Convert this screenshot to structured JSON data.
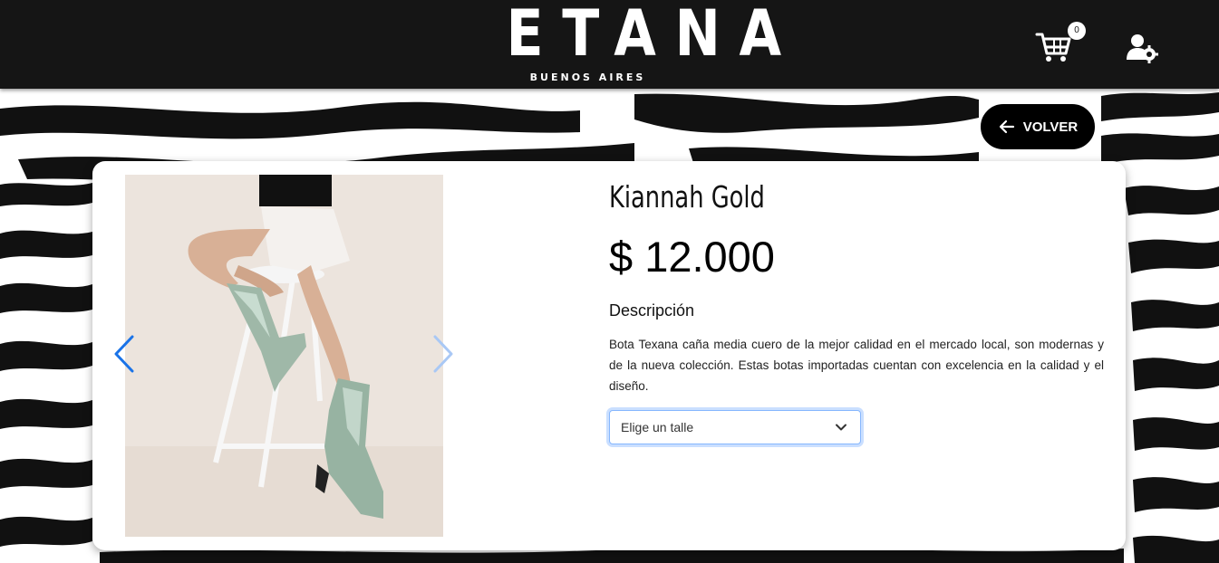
{
  "header": {
    "logo_main": "ETANA",
    "logo_sub": "BUENOS AIRES",
    "cart_count": "0"
  },
  "back_button": {
    "label": "VOLVER"
  },
  "product": {
    "name": "Kiannah Gold",
    "price": "$ 12.000",
    "description_heading": "Descripción",
    "description": "Bota Texana caña media cuero de la mejor calidad en el mercado local, son modernas y de la nueva colección. Estas botas importadas cuentan con excelencia en la calidad y el diseño.",
    "size_select_placeholder": "Elige un talle"
  },
  "icons": {
    "cart": "cart-icon",
    "user_settings": "user-settings-icon",
    "back_arrow": "arrow-left-icon",
    "carousel_prev": "chevron-left-icon",
    "carousel_next": "chevron-right-icon",
    "select_caret": "chevron-down-icon"
  },
  "colors": {
    "header_bg": "#151515",
    "accent_blue": "#0d6efd",
    "button_bg": "#000000"
  }
}
